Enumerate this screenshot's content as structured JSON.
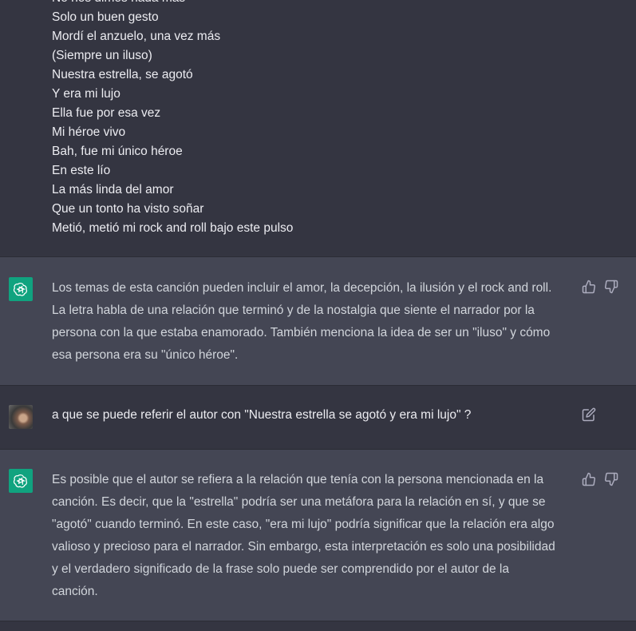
{
  "lyrics": {
    "lines": [
      "No nos dimos nada más",
      "Solo un buen gesto",
      "Mordí el anzuelo, una vez más",
      "(Siempre un iluso)",
      "Nuestra estrella, se agotó",
      "Y era mi lujo",
      "Ella fue por esa vez",
      "Mi héroe vivo",
      "Bah, fue mi único héroe",
      "En este lío",
      "La más linda del amor",
      "Que un tonto ha visto soñar",
      "Metió, metió mi rock and roll bajo este pulso"
    ]
  },
  "messages": {
    "bot1": {
      "lines": [
        "Los temas de esta canción pueden incluir el amor, la decepción, la ilusión y el rock and roll.",
        "La letra habla de una relación que terminó y de la nostalgia que siente el narrador por la",
        "persona con la que estaba enamorado. También menciona la idea de ser un \"iluso\" y cómo",
        "esa persona era su \"único héroe\"."
      ]
    },
    "user2": {
      "text": "a que se puede referir el autor con \"Nuestra estrella se agotó y era mi lujo\" ?"
    },
    "bot2": {
      "lines": [
        "Es posible que el autor se refiera a la relación que tenía con la persona mencionada en la",
        "canción. Es decir, que la \"estrella\" podría ser una metáfora para la relación en sí, y que se",
        "\"agotó\" cuando terminó. En este caso, \"era mi lujo\" podría significar que la relación era algo",
        "valioso y precioso para el narrador. Sin embargo, esta interpretación es solo una posibilidad",
        "y el verdadero significado de la frase solo puede ser comprendido por el autor de la",
        "canción."
      ]
    }
  },
  "icons": {
    "assistant_avatar": "openai-logo-icon",
    "user_avatar": "user-photo-avatar",
    "thumbs_up": "thumbs-up-icon",
    "thumbs_down": "thumbs-down-icon",
    "edit": "edit-icon"
  },
  "colors": {
    "background": "#343541",
    "assistant_background": "#444654",
    "assistant_avatar": "#10a37f",
    "text": "#d1d5db",
    "icon": "#acacbe"
  }
}
